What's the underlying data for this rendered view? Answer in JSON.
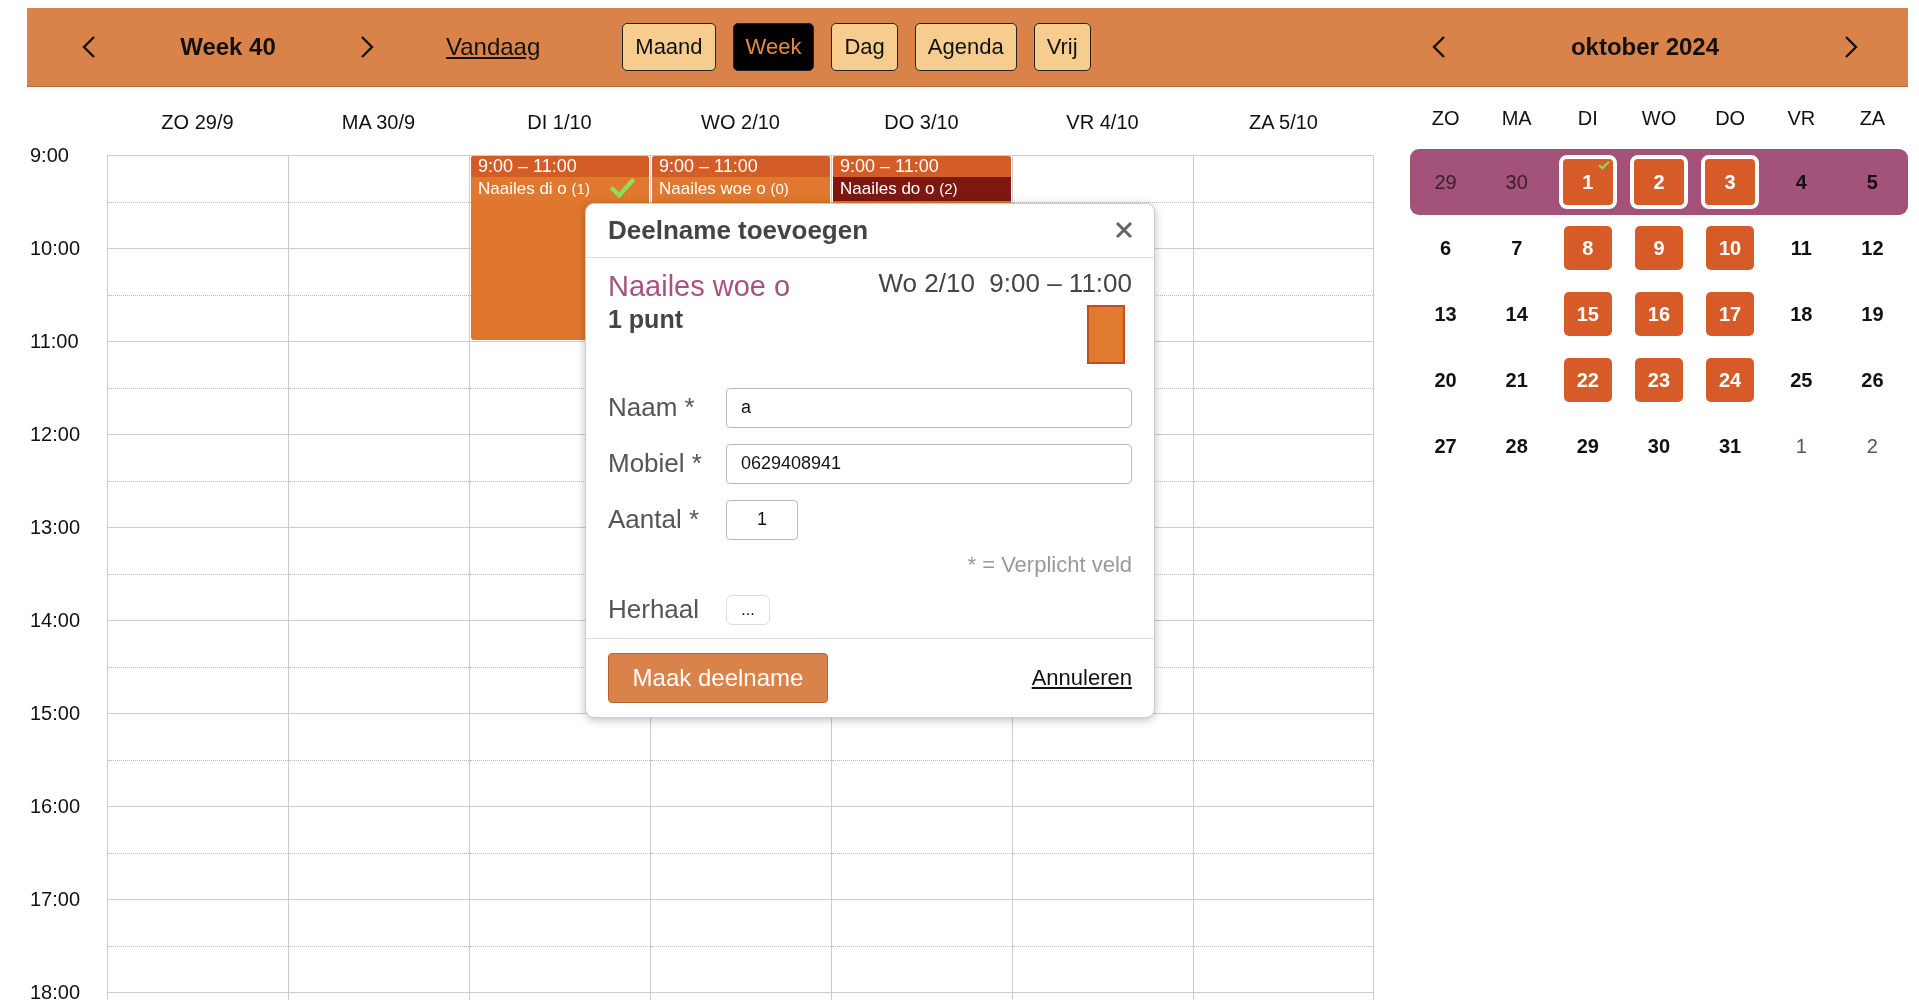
{
  "toolbar": {
    "week_label": "Week 40",
    "today_link": "Vandaag",
    "view_buttons": [
      {
        "label": "Maand",
        "selected": false
      },
      {
        "label": "Week",
        "selected": true
      },
      {
        "label": "Dag",
        "selected": false
      },
      {
        "label": "Agenda",
        "selected": false
      },
      {
        "label": "Vrij",
        "selected": false
      }
    ]
  },
  "week_view": {
    "hours": [
      "9:00",
      "10:00",
      "11:00",
      "12:00",
      "13:00",
      "14:00",
      "15:00",
      "16:00",
      "17:00",
      "18:00"
    ],
    "days": [
      {
        "label": "ZO 29/9"
      },
      {
        "label": "MA 30/9"
      },
      {
        "label": "DI 1/10",
        "events": [
          {
            "time": "9:00 – 11:00",
            "title": "Naailes di o",
            "count": "(1)",
            "full": false,
            "checked": true
          }
        ]
      },
      {
        "label": "WO 2/10",
        "events": [
          {
            "time": "9:00 – 11:00",
            "title": "Naailes woe o",
            "count": "(0)",
            "full": false,
            "checked": false
          }
        ]
      },
      {
        "label": "DO 3/10",
        "events": [
          {
            "time": "9:00 – 11:00",
            "title": "Naailes do o",
            "count": "(2)",
            "full": true,
            "checked": false
          }
        ]
      },
      {
        "label": "VR 4/10"
      },
      {
        "label": "ZA 5/10"
      }
    ]
  },
  "mini_calendar": {
    "title": "oktober 2024",
    "weekdays": [
      "ZO",
      "MA",
      "DI",
      "WO",
      "DO",
      "VR",
      "ZA"
    ],
    "weeks": [
      {
        "selected": true,
        "days": [
          {
            "label": "29",
            "kind": "other",
            "checked": false
          },
          {
            "label": "30",
            "kind": "other",
            "checked": false
          },
          {
            "label": "1",
            "kind": "event",
            "checked": true
          },
          {
            "label": "2",
            "kind": "event",
            "checked": false
          },
          {
            "label": "3",
            "kind": "event",
            "checked": false
          },
          {
            "label": "4",
            "kind": "normal",
            "checked": false
          },
          {
            "label": "5",
            "kind": "normal",
            "checked": false
          }
        ]
      },
      {
        "selected": false,
        "days": [
          {
            "label": "6",
            "kind": "normal",
            "checked": false
          },
          {
            "label": "7",
            "kind": "normal",
            "checked": false
          },
          {
            "label": "8",
            "kind": "event",
            "checked": false
          },
          {
            "label": "9",
            "kind": "event",
            "checked": false
          },
          {
            "label": "10",
            "kind": "event",
            "checked": false
          },
          {
            "label": "11",
            "kind": "normal",
            "checked": false
          },
          {
            "label": "12",
            "kind": "normal",
            "checked": false
          }
        ]
      },
      {
        "selected": false,
        "days": [
          {
            "label": "13",
            "kind": "normal",
            "checked": false
          },
          {
            "label": "14",
            "kind": "normal",
            "checked": false
          },
          {
            "label": "15",
            "kind": "event",
            "checked": false
          },
          {
            "label": "16",
            "kind": "event",
            "checked": false
          },
          {
            "label": "17",
            "kind": "event",
            "checked": false
          },
          {
            "label": "18",
            "kind": "normal",
            "checked": false
          },
          {
            "label": "19",
            "kind": "normal",
            "checked": false
          }
        ]
      },
      {
        "selected": false,
        "days": [
          {
            "label": "20",
            "kind": "normal",
            "checked": false
          },
          {
            "label": "21",
            "kind": "normal",
            "checked": false
          },
          {
            "label": "22",
            "kind": "event",
            "checked": false
          },
          {
            "label": "23",
            "kind": "event",
            "checked": false
          },
          {
            "label": "24",
            "kind": "event",
            "checked": false
          },
          {
            "label": "25",
            "kind": "normal",
            "checked": false
          },
          {
            "label": "26",
            "kind": "normal",
            "checked": false
          }
        ]
      },
      {
        "selected": false,
        "days": [
          {
            "label": "27",
            "kind": "normal",
            "checked": false
          },
          {
            "label": "28",
            "kind": "normal",
            "checked": false
          },
          {
            "label": "29",
            "kind": "normal",
            "checked": false
          },
          {
            "label": "30",
            "kind": "normal",
            "checked": false
          },
          {
            "label": "31",
            "kind": "normal",
            "checked": false
          },
          {
            "label": "1",
            "kind": "other",
            "checked": false
          },
          {
            "label": "2",
            "kind": "other",
            "checked": false
          }
        ]
      }
    ]
  },
  "dialog": {
    "title": "Deelname toevoegen",
    "course": "Naailes woe o",
    "points": "1 punt",
    "date": "Wo 2/10",
    "time": "9:00 – 11:00",
    "color": "#e07a30",
    "fields": [
      {
        "label": "Naam *",
        "value": "a",
        "kind": "text"
      },
      {
        "label": "Mobiel *",
        "value": "0629408941",
        "kind": "text"
      },
      {
        "label": "Aantal *",
        "value": "1",
        "kind": "number"
      }
    ],
    "required_note": "* = Verplicht veld",
    "repeat_label": "Herhaal",
    "repeat_button": "...",
    "submit": "Maak deelname",
    "cancel": "Annuleren"
  }
}
